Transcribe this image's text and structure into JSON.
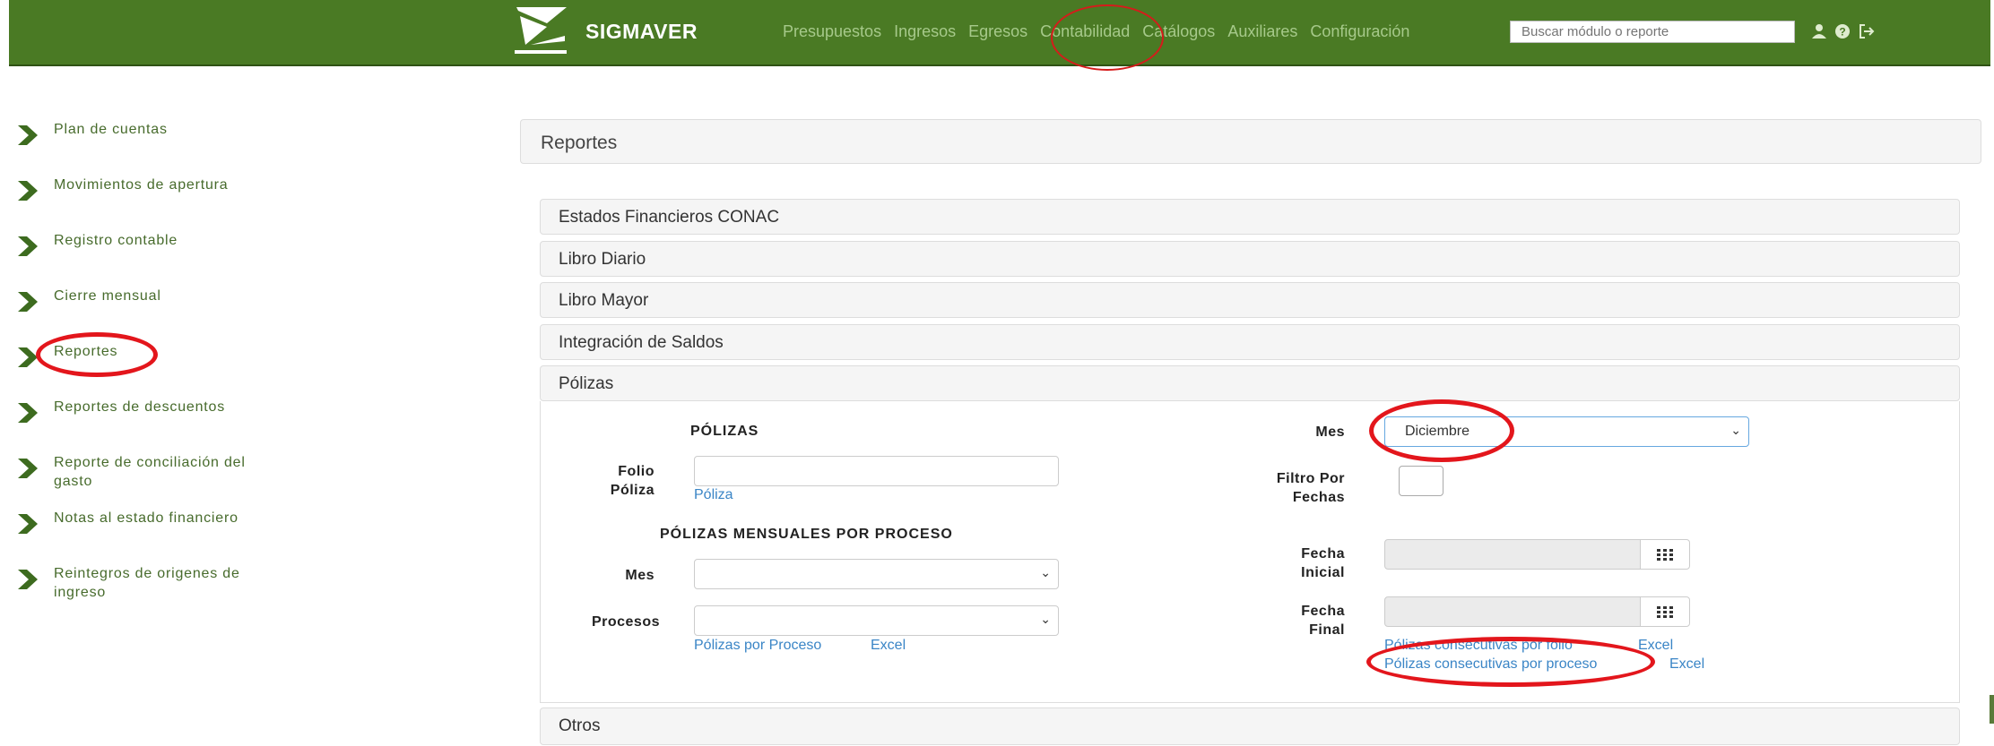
{
  "app": {
    "brand": "SIGMAVER",
    "nav": [
      "Presupuestos",
      "Ingresos",
      "Egresos",
      "Contabilidad",
      "Catálogos",
      "Auxiliares",
      "Configuración"
    ],
    "search_placeholder": "Buscar módulo o reporte",
    "icons": [
      "user-icon",
      "help-icon",
      "logout-icon"
    ]
  },
  "sidebar": {
    "items": [
      {
        "label": "Plan de cuentas"
      },
      {
        "label": "Movimientos de apertura"
      },
      {
        "label": "Registro contable"
      },
      {
        "label": "Cierre mensual"
      },
      {
        "label": "Reportes"
      },
      {
        "label": "Reportes de descuentos"
      },
      {
        "label": "Reporte de conciliación del gasto"
      },
      {
        "label": "Notas al estado financiero"
      },
      {
        "label": "Reintegros de origenes de ingreso"
      }
    ]
  },
  "main": {
    "title": "Reportes",
    "sections": [
      "Estados Financieros CONAC",
      "Libro Diario",
      "Libro Mayor",
      "Integración de Saldos",
      "Pólizas"
    ],
    "last_section": "Otros",
    "polizas": {
      "heading": "PÓLIZAS",
      "folio_label": "Folio Póliza",
      "folio_value": "",
      "poliza_link": "Póliza",
      "mensuales_heading": "PÓLIZAS MENSUALES POR PROCESO",
      "mes_label": "Mes",
      "mes_value": "",
      "procesos_label": "Procesos",
      "procesos_value": "",
      "polizas_por_proceso_link": "Pólizas por Proceso",
      "excel_link": "Excel",
      "right_mes_label": "Mes",
      "right_mes_value": "Diciembre",
      "filtro_label": "Filtro Por Fechas",
      "fecha_inicial_label": "Fecha Inicial",
      "fecha_final_label": "Fecha Final",
      "consec_folio_link": "Pólizas consecutivas por folio",
      "consec_proceso_link": "Pólizas consecutivas por proceso",
      "excel_link_1": "Excel",
      "excel_link_2": "Excel"
    }
  },
  "colors": {
    "header_bg": "#4a7a24",
    "sidebar_text": "#476b2c",
    "link": "#3a85c6",
    "highlight": "#e3161c"
  }
}
